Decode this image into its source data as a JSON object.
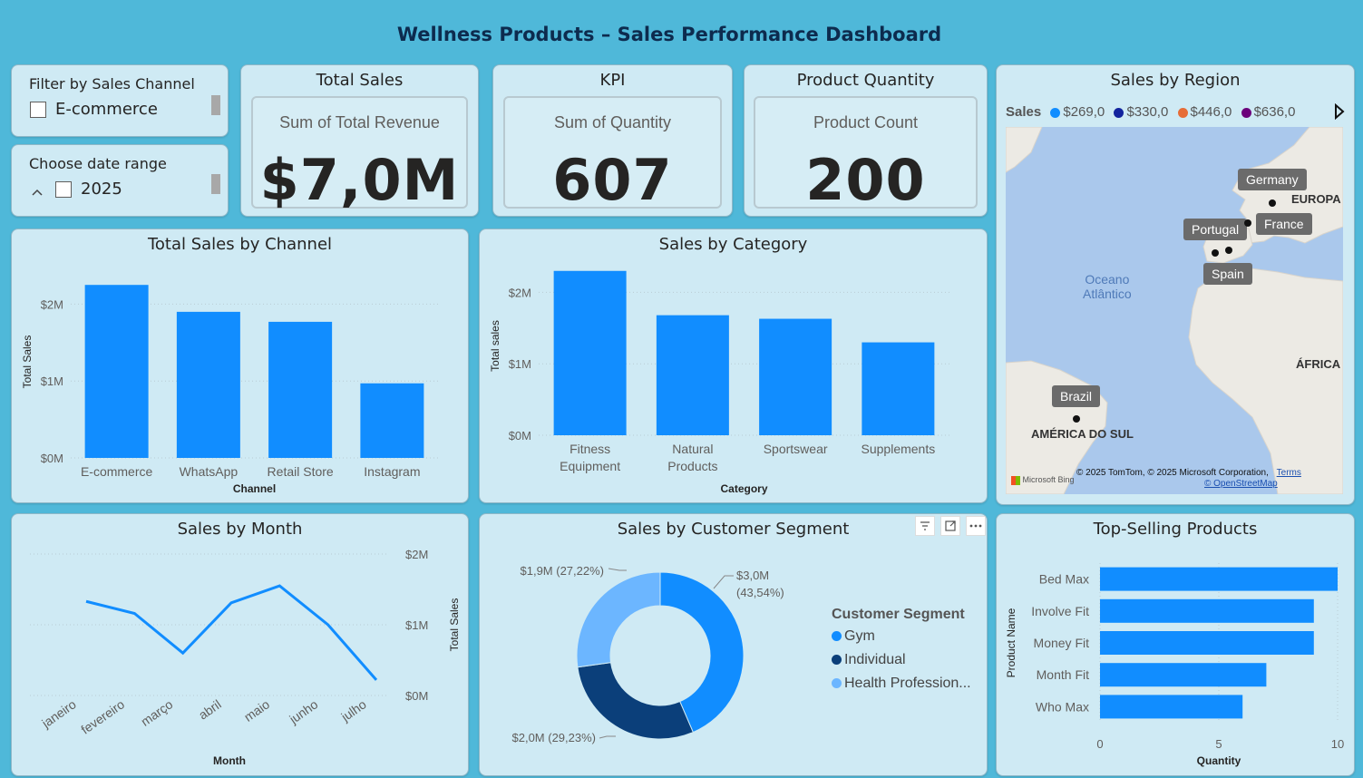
{
  "page_title": "Wellness Products – Sales Performance Dashboard",
  "slicer_channel": {
    "title": "Filter by Sales Channel",
    "item": "E-commerce"
  },
  "slicer_date": {
    "title": "Choose date range",
    "item": "2025"
  },
  "cards": [
    {
      "title": "Total Sales",
      "label": "Sum of Total Revenue",
      "value": "$7,0M"
    },
    {
      "title": "KPI",
      "label": "Sum of Quantity",
      "value": "607"
    },
    {
      "title": "Product Quantity",
      "label": "Product Count",
      "value": "200"
    }
  ],
  "region": {
    "title": "Sales by Region",
    "legend_title": "Sales",
    "legend": [
      {
        "label": "$269,0",
        "color": "#118dff"
      },
      {
        "label": "$330,0",
        "color": "#12239e"
      },
      {
        "label": "$446,0",
        "color": "#e66c37"
      },
      {
        "label": "$636,0",
        "color": "#6b007b"
      }
    ],
    "labels": [
      "Germany",
      "Portugal",
      "France",
      "Spain",
      "Brazil"
    ],
    "place_names": [
      "EUROPA",
      "Oceano\nAtlântico",
      "ÁFRICA",
      "AMÉRICA DO SUL"
    ],
    "attribution": "© 2025 TomTom, © 2025 Microsoft Corporation,",
    "terms": "Terms",
    "osm": "© OpenStreetMap",
    "bing": "Microsoft Bing"
  },
  "chart_data": [
    {
      "type": "bar",
      "title": "Total Sales by Channel",
      "categories": [
        "E-commerce",
        "WhatsApp",
        "Retail Store",
        "Instagram"
      ],
      "values": [
        2.25,
        1.9,
        1.77,
        0.97
      ],
      "xlabel": "Channel",
      "ylabel": "Total Sales",
      "yticks": [
        "$0M",
        "$1M",
        "$2M"
      ],
      "ylim": [
        0,
        2.5
      ]
    },
    {
      "type": "bar",
      "title": "Sales by Category",
      "categories": [
        "Fitness\nEquipment",
        "Natural\nProducts",
        "Sportswear",
        "Supplements"
      ],
      "values": [
        2.3,
        1.68,
        1.63,
        1.3
      ],
      "xlabel": "Category",
      "ylabel": "Total sales",
      "yticks": [
        "$0M",
        "$1M",
        "$2M"
      ],
      "ylim": [
        0,
        2.5
      ]
    },
    {
      "type": "line",
      "title": "Sales by Month",
      "categories": [
        "janeiro",
        "fevereiro",
        "março",
        "abril",
        "maio",
        "junho",
        "julho"
      ],
      "values": [
        1.33,
        1.16,
        0.6,
        1.31,
        1.55,
        1.0,
        0.22
      ],
      "xlabel": "Month",
      "ylabel": "Total Sales",
      "yticks": [
        "$0M",
        "$1M",
        "$2M"
      ],
      "ylim": [
        0,
        2.0
      ]
    },
    {
      "type": "pie",
      "title": "Sales by Customer Segment",
      "legend_title": "Customer Segment",
      "slices": [
        {
          "name": "Gym",
          "value": 43.54,
          "label": "$3,0M\n(43,54%)",
          "color": "#118dff"
        },
        {
          "name": "Individual",
          "value": 29.23,
          "label": "$2,0M (29,23%)",
          "color": "#0b3f7a"
        },
        {
          "name": "Health Profession...",
          "value": 27.22,
          "label": "$1,9M (27,22%)",
          "color": "#6cb6ff"
        }
      ]
    },
    {
      "type": "bar",
      "title": "Top-Selling Products",
      "orientation": "horizontal",
      "categories": [
        "Bed Max",
        "Involve Fit",
        "Money Fit",
        "Month Fit",
        "Who Max"
      ],
      "values": [
        10,
        9,
        9,
        7,
        6
      ],
      "xlabel": "Quantity",
      "ylabel": "Product Name",
      "xticks": [
        "0",
        "5",
        "10"
      ],
      "xlim": [
        0,
        10
      ]
    }
  ]
}
